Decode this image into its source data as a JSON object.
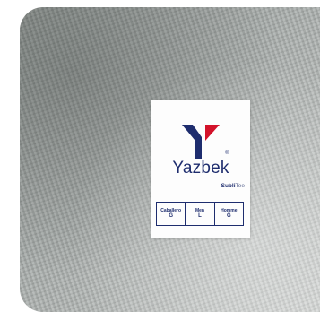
{
  "label": {
    "brand": "Yazbek",
    "registered_mark": "®",
    "product_bold": "Subli",
    "product_light": "Tee",
    "sizes": [
      {
        "lang": "Caballero",
        "size": "G"
      },
      {
        "lang": "Men",
        "size": "L"
      },
      {
        "lang": "Homme",
        "size": "G"
      }
    ]
  },
  "colors": {
    "brand_navy": "#1e2d6e",
    "brand_red": "#d3122a",
    "fabric_gray": "#a9aeac"
  },
  "icons": {
    "logo": "yazbek-y-logo-icon"
  }
}
